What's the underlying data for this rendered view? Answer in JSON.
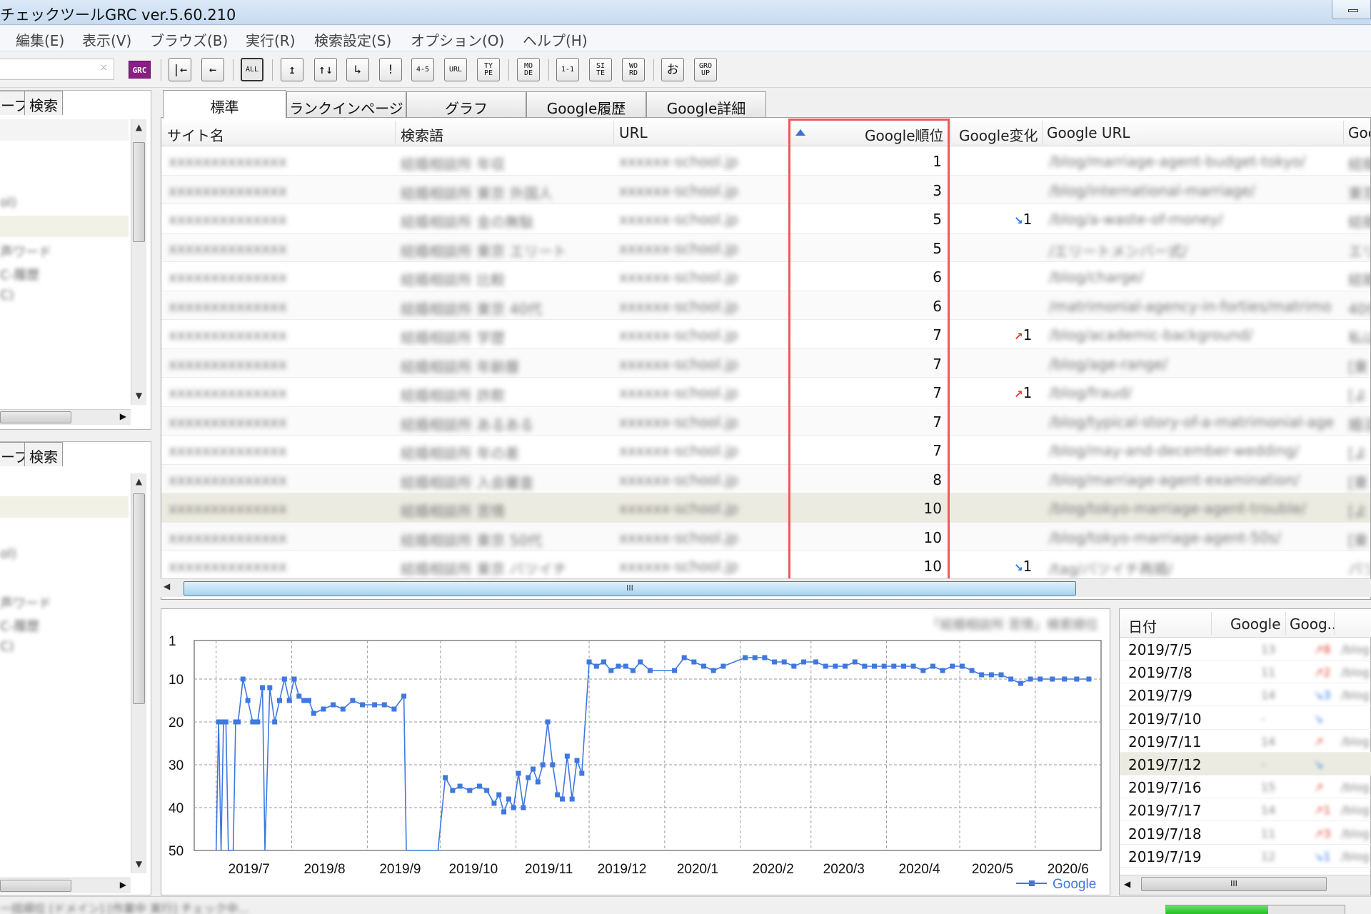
{
  "window": {
    "title": "チェックツールGRC  ver.5.60.210"
  },
  "menu": [
    "編集(E)",
    "表示(V)",
    "ブラウズ(B)",
    "実行(R)",
    "検索設定(S)",
    "オプション(O)",
    "ヘルプ(H)"
  ],
  "toolbar": {
    "logo": "GRC",
    "search_clear": "×",
    "buttons": [
      {
        "name": "first-icon",
        "label": "|←"
      },
      {
        "name": "back-icon",
        "label": "←"
      },
      {
        "name": "all-button",
        "label": "ALL"
      },
      {
        "name": "up-icon",
        "label": "↥"
      },
      {
        "name": "updown-icon",
        "label": "↑↓"
      },
      {
        "name": "corner-icon",
        "label": "↳"
      },
      {
        "name": "exclamation-icon",
        "label": "!"
      },
      {
        "name": "range-button",
        "label": "4-5"
      },
      {
        "name": "url-button",
        "label": "URL"
      },
      {
        "name": "type-button",
        "label": "TY PE"
      },
      {
        "name": "mode-button",
        "label": "MO DE"
      },
      {
        "name": "one-one-button",
        "label": "1-1"
      },
      {
        "name": "site-button",
        "label": "SI TE"
      },
      {
        "name": "word-button",
        "label": "WO RD"
      },
      {
        "name": "o-button",
        "label": "お"
      },
      {
        "name": "group-button",
        "label": "GRO UP"
      }
    ]
  },
  "left_pane": {
    "tab_group": "ープ",
    "tab_search": "検索",
    "blur_labels": [
      "ol)",
      "声ワード",
      "C-履歴",
      "C)"
    ]
  },
  "tabs": [
    "標準",
    "ランクインページ",
    "グラフ",
    "Google履歴",
    "Google詳細"
  ],
  "grid": {
    "columns": [
      "サイト名",
      "検索語",
      "URL",
      "Google順位",
      "Google変化",
      "Google URL",
      "Goo"
    ],
    "rows": [
      {
        "site": "xxxxxxxxxxxxxx",
        "keyword": "結婚相談所 年収",
        "url": "xxxxxx-school.jp",
        "rank": "1",
        "change": "",
        "dir": "",
        "gurl": "/blog/marriage-agent-budget-tokyo/",
        "extra": "結婚"
      },
      {
        "site": "xxxxxxxxxxxxxx",
        "keyword": "結婚相談所 東京 外国人",
        "url": "xxxxxx-school.jp",
        "rank": "3",
        "change": "",
        "dir": "",
        "gurl": "/blog/international-marriage/",
        "extra": "東京"
      },
      {
        "site": "xxxxxxxxxxxxxx",
        "keyword": "結婚相談所 金の無駄",
        "url": "xxxxxx-school.jp",
        "rank": "5",
        "change": "1",
        "dir": "down",
        "gurl": "/blog/a-waste-of-money/",
        "extra": "結婚"
      },
      {
        "site": "xxxxxxxxxxxxxx",
        "keyword": "結婚相談所 東京 エリート",
        "url": "xxxxxx-school.jp",
        "rank": "5",
        "change": "",
        "dir": "",
        "gurl": "/エリートメンバー式/",
        "extra": "エリ"
      },
      {
        "site": "xxxxxxxxxxxxxx",
        "keyword": "結婚相談所 比較",
        "url": "xxxxxx-school.jp",
        "rank": "6",
        "change": "",
        "dir": "",
        "gurl": "/blog/charge/",
        "extra": "結婚"
      },
      {
        "site": "xxxxxxxxxxxxxx",
        "keyword": "結婚相談所 東京 40代",
        "url": "xxxxxx-school.jp",
        "rank": "6",
        "change": "",
        "dir": "",
        "gurl": "/matrimonial-agency-in-forties/matrimo",
        "extra": "40代"
      },
      {
        "site": "xxxxxxxxxxxxxx",
        "keyword": "結婚相談所 学歴",
        "url": "xxxxxx-school.jp",
        "rank": "7",
        "change": "1",
        "dir": "up",
        "gurl": "/blog/academic-background/",
        "extra": "私は"
      },
      {
        "site": "xxxxxxxxxxxxxx",
        "keyword": "結婚相談所 年齢層",
        "url": "xxxxxx-school.jp",
        "rank": "7",
        "change": "",
        "dir": "",
        "gurl": "/blog/age-range/",
        "extra": "[東"
      },
      {
        "site": "xxxxxxxxxxxxxx",
        "keyword": "結婚相談所 詐欺",
        "url": "xxxxxx-school.jp",
        "rank": "7",
        "change": "1",
        "dir": "up",
        "gurl": "/blog/fraud/",
        "extra": "[よ"
      },
      {
        "site": "xxxxxxxxxxxxxx",
        "keyword": "結婚相談所 あるある",
        "url": "xxxxxx-school.jp",
        "rank": "7",
        "change": "",
        "dir": "",
        "gurl": "/blog/typical-story-of-a-matrimonial-age",
        "extra": "婚活"
      },
      {
        "site": "xxxxxxxxxxxxxx",
        "keyword": "結婚相談所 年の差",
        "url": "xxxxxx-school.jp",
        "rank": "7",
        "change": "",
        "dir": "",
        "gurl": "/blog/may-and-december-wedding/",
        "extra": "[よ"
      },
      {
        "site": "xxxxxxxxxxxxxx",
        "keyword": "結婚相談所 入会審査",
        "url": "xxxxxx-school.jp",
        "rank": "8",
        "change": "",
        "dir": "",
        "gurl": "/blog/marriage-agent-examination/",
        "extra": "[東"
      },
      {
        "site": "xxxxxxxxxxxxxx",
        "keyword": "結婚相談所 苦情",
        "url": "xxxxxx-school.jp",
        "rank": "10",
        "change": "",
        "dir": "",
        "gurl": "/blog/tokyo-marriage-agent-trouble/",
        "extra": "[よ"
      },
      {
        "site": "xxxxxxxxxxxxxx",
        "keyword": "結婚相談所 東京 50代",
        "url": "xxxxxx-school.jp",
        "rank": "10",
        "change": "",
        "dir": "",
        "gurl": "/blog/tokyo-marriage-agent-50s/",
        "extra": "[東"
      },
      {
        "site": "xxxxxxxxxxxxxx",
        "keyword": "結婚相談所 東京 バツイチ",
        "url": "xxxxxx-school.jp",
        "rank": "10",
        "change": "1",
        "dir": "down",
        "gurl": "/tag/バツイチ再婚/",
        "extra": "バツ"
      }
    ],
    "hscroll_grip": "III"
  },
  "chart": {
    "keyword_blur": "「結婚相談所 苦情」検索順位",
    "yticks": [
      "1",
      "10",
      "20",
      "30",
      "40",
      "50"
    ],
    "xticks": [
      "2019/7",
      "2019/8",
      "2019/9",
      "2019/10",
      "2019/11",
      "2019/12",
      "2020/1",
      "2020/2",
      "2020/3",
      "2020/4",
      "2020/5",
      "2020/6"
    ],
    "legend": "Google",
    "line_color": "#3f78e0"
  },
  "chart_data": {
    "type": "line",
    "xlabel": "",
    "ylabel": "",
    "ylim": [
      50,
      1
    ],
    "y_inverted": true,
    "grid": true,
    "legend": "bottom-right",
    "x_ticks": [
      "2019/7",
      "2019/8",
      "2019/9",
      "2019/10",
      "2019/11",
      "2019/12",
      "2020/1",
      "2020/2",
      "2020/3",
      "2020/4",
      "2020/5",
      "2020/6"
    ],
    "series": [
      {
        "name": "Google",
        "points": [
          [
            "2019-07-01",
            50
          ],
          [
            "2019-07-02",
            20
          ],
          [
            "2019-07-03",
            50
          ],
          [
            "2019-07-04",
            20
          ],
          [
            "2019-07-05",
            20
          ],
          [
            "2019-07-06",
            50
          ],
          [
            "2019-07-08",
            50
          ],
          [
            "2019-07-09",
            20
          ],
          [
            "2019-07-10",
            20
          ],
          [
            "2019-07-12",
            10
          ],
          [
            "2019-07-14",
            15
          ],
          [
            "2019-07-16",
            20
          ],
          [
            "2019-07-18",
            20
          ],
          [
            "2019-07-20",
            12
          ],
          [
            "2019-07-21",
            50
          ],
          [
            "2019-07-23",
            12
          ],
          [
            "2019-07-25",
            20
          ],
          [
            "2019-07-27",
            15
          ],
          [
            "2019-07-29",
            10
          ],
          [
            "2019-07-31",
            15
          ],
          [
            "2019-08-02",
            10
          ],
          [
            "2019-08-04",
            14
          ],
          [
            "2019-08-06",
            15
          ],
          [
            "2019-08-08",
            15
          ],
          [
            "2019-08-10",
            18
          ],
          [
            "2019-08-14",
            17
          ],
          [
            "2019-08-18",
            16
          ],
          [
            "2019-08-22",
            17
          ],
          [
            "2019-08-26",
            15
          ],
          [
            "2019-08-30",
            16
          ],
          [
            "2019-09-04",
            16
          ],
          [
            "2019-09-08",
            16
          ],
          [
            "2019-09-12",
            17
          ],
          [
            "2019-09-16",
            14
          ],
          [
            "2019-09-17",
            50
          ],
          [
            "2019-09-30",
            50
          ],
          [
            "2019-10-03",
            33
          ],
          [
            "2019-10-06",
            36
          ],
          [
            "2019-10-09",
            35
          ],
          [
            "2019-10-13",
            36
          ],
          [
            "2019-10-17",
            35
          ],
          [
            "2019-10-20",
            36
          ],
          [
            "2019-10-23",
            39
          ],
          [
            "2019-10-25",
            37
          ],
          [
            "2019-10-27",
            41
          ],
          [
            "2019-10-29",
            38
          ],
          [
            "2019-10-31",
            40
          ],
          [
            "2019-11-02",
            32
          ],
          [
            "2019-11-04",
            40
          ],
          [
            "2019-11-06",
            33
          ],
          [
            "2019-11-08",
            31
          ],
          [
            "2019-11-10",
            34
          ],
          [
            "2019-11-12",
            30
          ],
          [
            "2019-11-14",
            20
          ],
          [
            "2019-11-16",
            30
          ],
          [
            "2019-11-18",
            37
          ],
          [
            "2019-11-20",
            38
          ],
          [
            "2019-11-22",
            28
          ],
          [
            "2019-11-24",
            38
          ],
          [
            "2019-11-26",
            29
          ],
          [
            "2019-11-28",
            32
          ],
          [
            "2019-12-01",
            6
          ],
          [
            "2019-12-04",
            7
          ],
          [
            "2019-12-07",
            6
          ],
          [
            "2019-12-10",
            8
          ],
          [
            "2019-12-13",
            7
          ],
          [
            "2019-12-16",
            7
          ],
          [
            "2019-12-19",
            8
          ],
          [
            "2019-12-22",
            6
          ],
          [
            "2019-12-26",
            8
          ],
          [
            "2020-01-05",
            8
          ],
          [
            "2020-01-09",
            5
          ],
          [
            "2020-01-13",
            6
          ],
          [
            "2020-01-17",
            7
          ],
          [
            "2020-01-21",
            8
          ],
          [
            "2020-01-25",
            7
          ],
          [
            "2020-02-03",
            5
          ],
          [
            "2020-02-07",
            5
          ],
          [
            "2020-02-11",
            5
          ],
          [
            "2020-02-15",
            6
          ],
          [
            "2020-02-19",
            6
          ],
          [
            "2020-02-23",
            7
          ],
          [
            "2020-02-27",
            6
          ],
          [
            "2020-03-03",
            6
          ],
          [
            "2020-03-07",
            7
          ],
          [
            "2020-03-11",
            7
          ],
          [
            "2020-03-15",
            7
          ],
          [
            "2020-03-19",
            6
          ],
          [
            "2020-03-23",
            7
          ],
          [
            "2020-03-27",
            7
          ],
          [
            "2020-03-31",
            7
          ],
          [
            "2020-04-04",
            7
          ],
          [
            "2020-04-08",
            7
          ],
          [
            "2020-04-12",
            7
          ],
          [
            "2020-04-16",
            8
          ],
          [
            "2020-04-20",
            7
          ],
          [
            "2020-04-24",
            8
          ],
          [
            "2020-04-28",
            7
          ],
          [
            "2020-05-02",
            7
          ],
          [
            "2020-05-06",
            8
          ],
          [
            "2020-05-10",
            9
          ],
          [
            "2020-05-14",
            9
          ],
          [
            "2020-05-18",
            9
          ],
          [
            "2020-05-22",
            10
          ],
          [
            "2020-05-26",
            11
          ],
          [
            "2020-05-30",
            10
          ],
          [
            "2020-06-03",
            10
          ],
          [
            "2020-06-08",
            10
          ],
          [
            "2020-06-13",
            10
          ],
          [
            "2020-06-18",
            10
          ],
          [
            "2020-06-23",
            10
          ]
        ]
      }
    ]
  },
  "dates": {
    "headers": [
      "日付",
      "Google",
      "Goog.."
    ],
    "rows": [
      {
        "date": "2019/7/5",
        "rank": "13",
        "chg": "↗8",
        "url": "/blog"
      },
      {
        "date": "2019/7/8",
        "rank": "11",
        "chg": "↗2",
        "url": "/blog"
      },
      {
        "date": "2019/7/9",
        "rank": "14",
        "chg": "↘3",
        "url": "/blog"
      },
      {
        "date": "2019/7/10",
        "rank": "-",
        "chg": "↘",
        "url": ""
      },
      {
        "date": "2019/7/11",
        "rank": "14",
        "chg": "↗",
        "url": "/blog"
      },
      {
        "date": "2019/7/12",
        "rank": "-",
        "chg": "↘",
        "url": ""
      },
      {
        "date": "2019/7/16",
        "rank": "15",
        "chg": "↗",
        "url": "/blog"
      },
      {
        "date": "2019/7/17",
        "rank": "14",
        "chg": "↗1",
        "url": "/blog"
      },
      {
        "date": "2019/7/18",
        "rank": "11",
        "chg": "↗3",
        "url": "/blog"
      },
      {
        "date": "2019/7/19",
        "rank": "12",
        "chg": "↘1",
        "url": "/blog"
      }
    ],
    "hscroll_grip": "III"
  },
  "status": {
    "text": "一括順位 [ドメイン] [作業中 実行] チェック中...",
    "progress": 0.57
  }
}
